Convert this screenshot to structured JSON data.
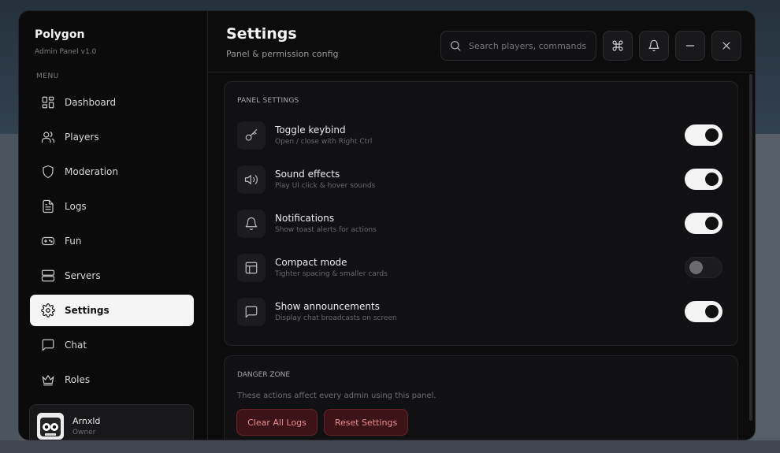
{
  "app": {
    "brand": "Polygon",
    "subtitle": "Admin Panel  v1.0",
    "menu_label": "MENU"
  },
  "sidebar": {
    "items": [
      {
        "label": "Dashboard",
        "icon": "dashboard-icon"
      },
      {
        "label": "Players",
        "icon": "users-icon"
      },
      {
        "label": "Moderation",
        "icon": "shield-icon"
      },
      {
        "label": "Logs",
        "icon": "file-text-icon"
      },
      {
        "label": "Fun",
        "icon": "gamepad-icon"
      },
      {
        "label": "Servers",
        "icon": "server-icon"
      },
      {
        "label": "Settings",
        "icon": "gear-icon",
        "active": true
      },
      {
        "label": "Chat",
        "icon": "message-icon"
      },
      {
        "label": "Roles",
        "icon": "crown-icon"
      }
    ]
  },
  "user": {
    "name": "Arnxld",
    "role": "Owner"
  },
  "header": {
    "title": "Settings",
    "subtitle": "Panel & permission config",
    "search_placeholder": "Search players, commands..."
  },
  "panel_settings": {
    "label": "PANEL SETTINGS",
    "items": [
      {
        "name": "Toggle keybind",
        "desc": "Open / close with Right Ctrl",
        "icon": "key-icon",
        "enabled": true
      },
      {
        "name": "Sound effects",
        "desc": "Play UI click & hover sounds",
        "icon": "volume-icon",
        "enabled": true
      },
      {
        "name": "Notifications",
        "desc": "Show toast alerts for actions",
        "icon": "bell-icon",
        "enabled": true
      },
      {
        "name": "Compact mode",
        "desc": "Tighter spacing & smaller cards",
        "icon": "layout-icon",
        "enabled": false
      },
      {
        "name": "Show announcements",
        "desc": "Display chat broadcasts on screen",
        "icon": "message-icon",
        "enabled": true
      }
    ]
  },
  "danger_zone": {
    "label": "DANGER ZONE",
    "desc": "These actions affect every admin using this panel.",
    "clear_logs": "Clear All Logs",
    "reset_settings": "Reset Settings"
  },
  "colors": {
    "background": "#0c0c0d",
    "active_nav": "#f5f5f5",
    "danger_bg": "#3c1417",
    "danger_text": "#ec8d93"
  }
}
